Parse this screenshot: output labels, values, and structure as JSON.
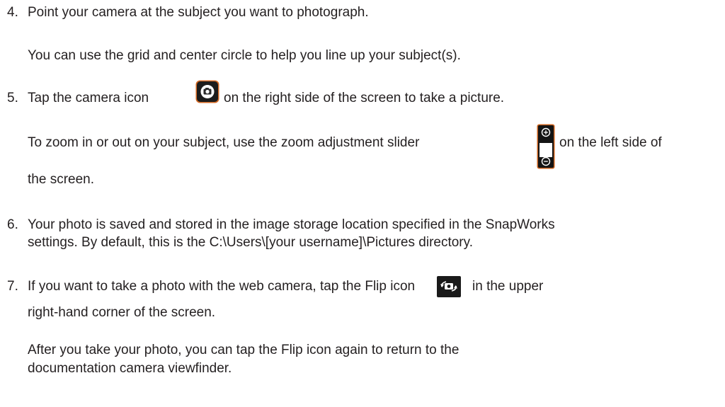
{
  "steps": [
    {
      "number": "4.",
      "main": "Point your camera at the subject you want to photograph.",
      "note": "You can use the grid and center circle to help you line up your subject(s)."
    },
    {
      "number": "5.",
      "main_before": "Tap the camera icon",
      "main_after": "on the right side of the screen to take a picture.",
      "note_before": "To zoom in or out on your subject, use the zoom adjustment slider",
      "note_after": "on the left side of",
      "note_wrap": "the screen."
    },
    {
      "number": "6.",
      "line1": "Your photo is saved and stored in the image storage location specified in the SnapWorks",
      "line2": "settings. By default, this is the C:\\Users\\[your username]\\Pictures directory."
    },
    {
      "number": "7.",
      "line1_before": "If you want to take a photo with the web camera, tap the Flip icon",
      "line1_after": "in the upper",
      "line2": "right-hand corner of the screen.",
      "note_line1": "After you take your photo, you can tap the Flip icon again to return to the",
      "note_line2": "documentation camera viewfinder."
    }
  ],
  "icons": {
    "camera": "camera-icon",
    "zoom_slider": "zoom-slider-icon",
    "flip": "flip-icon"
  },
  "colors": {
    "text": "#231f20",
    "icon_dark": "#1c1c1c",
    "icon_border": "#c9611d"
  }
}
